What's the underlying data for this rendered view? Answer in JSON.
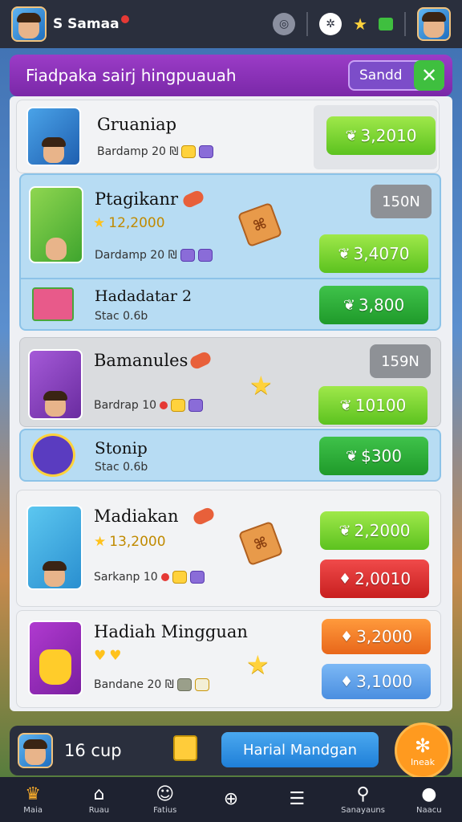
{
  "app": {
    "title": "S Samaa"
  },
  "header": {
    "title": "Fiadpaka sairj hingpuauah",
    "send_label": "Sandd",
    "close_symbol": "✕"
  },
  "items": [
    {
      "name": "Gruaniap",
      "subtitle": "Bardamp 20 ₪",
      "price": "3,2010",
      "currency_icon": "leaf"
    },
    {
      "name": "Ptagikanr",
      "rating": "12,2000",
      "subtitle": "Dardamp 20 ₪",
      "pill": "150N",
      "price": "3,4070",
      "currency_icon": "leaf"
    },
    {
      "name": "Hadadatar 2",
      "subtitle": "Stac 0.6b",
      "price": "3,800",
      "currency_icon": "leaf"
    },
    {
      "name": "Bamanules",
      "subtitle": "Bardrap 10",
      "pill": "159N",
      "price": "10100",
      "currency_icon": "leaf"
    },
    {
      "name": "Stonip",
      "subtitle": "Stac 0.6b",
      "price": "$300",
      "currency_icon": "leaf"
    },
    {
      "name": "Madiakan",
      "rating": "13,2000",
      "subtitle": "Sarkanp 10",
      "price": "2,2000",
      "price2": "2,0010",
      "currency_icon": "leaf"
    },
    {
      "name": "Hadiah Mingguan",
      "subtitle": "Bandane 20 ₪",
      "price": "3,2000",
      "price2": "3,1000",
      "currency_icon": "gem"
    }
  ],
  "bottom": {
    "cup_text": "16 cup",
    "cta_label": "Harial Mandgan",
    "circle_label": "Ineak"
  },
  "nav": [
    {
      "icon": "crown",
      "label": "Maia"
    },
    {
      "icon": "home",
      "label": "Ruau"
    },
    {
      "icon": "smile",
      "label": "Fatius"
    },
    {
      "icon": "compass",
      "label": ""
    },
    {
      "icon": "menu",
      "label": ""
    },
    {
      "icon": "search",
      "label": "Sanayauns"
    },
    {
      "icon": "user",
      "label": "Naacu"
    }
  ],
  "colors": {
    "topbar": "#2a2f3d",
    "header": "#8a32b8",
    "price_green": "#5cc21f",
    "price_red": "#d42a2a",
    "price_orange": "#f07a28",
    "price_blue": "#5a9ae8",
    "cta": "#2f8ee0",
    "circle": "#ff9a1f"
  }
}
